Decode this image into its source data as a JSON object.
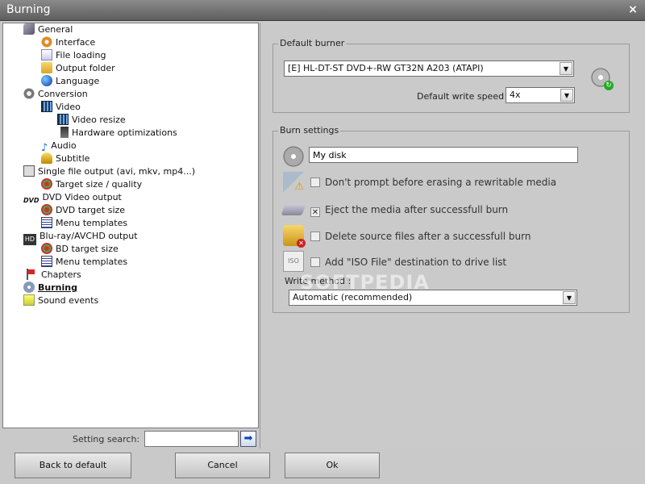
{
  "window": {
    "title": "Burning",
    "close_glyph": "×"
  },
  "tree": [
    {
      "label": "General",
      "icon": "wrench-icon",
      "selected": false
    },
    {
      "label": "Interface",
      "icon": "gear-icon",
      "selected": false
    },
    {
      "label": "File loading",
      "icon": "document-icon",
      "selected": false
    },
    {
      "label": "Output folder",
      "icon": "folder-icon",
      "selected": false
    },
    {
      "label": "Language",
      "icon": "globe-icon",
      "selected": false
    },
    {
      "label": "Conversion",
      "icon": "gear-icon",
      "selected": false
    },
    {
      "label": "Video",
      "icon": "film-icon",
      "selected": false
    },
    {
      "label": "Video resize",
      "icon": "film-icon",
      "selected": false
    },
    {
      "label": "Hardware optimizations",
      "icon": "chip-icon",
      "selected": false
    },
    {
      "label": "Audio",
      "icon": "music-note-icon",
      "selected": false
    },
    {
      "label": "Subtitle",
      "icon": "subtitle-icon",
      "selected": false
    },
    {
      "label": "Single file output (avi, mkv, mp4...)",
      "icon": "camera-icon",
      "selected": false
    },
    {
      "label": "Target size / quality",
      "icon": "target-icon",
      "selected": false
    },
    {
      "label": "DVD Video output",
      "icon": "dvd-icon",
      "selected": false
    },
    {
      "label": "DVD target size",
      "icon": "target-icon",
      "selected": false
    },
    {
      "label": "Menu templates",
      "icon": "menu-template-icon",
      "selected": false
    },
    {
      "label": "Blu-ray/AVCHD output",
      "icon": "hd-icon",
      "selected": false
    },
    {
      "label": "BD target size",
      "icon": "target-icon",
      "selected": false
    },
    {
      "label": "Menu templates",
      "icon": "menu-template-icon",
      "selected": false
    },
    {
      "label": "Chapters",
      "icon": "flag-icon",
      "selected": false
    },
    {
      "label": "Burning",
      "icon": "burn-icon",
      "selected": true
    },
    {
      "label": "Sound events",
      "icon": "sound-icon",
      "selected": false
    }
  ],
  "icon_text": {
    "dvd": "DVD",
    "hd": "HD",
    "note": "♪",
    "iso": "ISO"
  },
  "search": {
    "label": "Setting search:",
    "value": "",
    "go_glyph": "➡"
  },
  "default_burner": {
    "legend": "Default burner",
    "drive": "[E] HL-DT-ST DVD+-RW GT32N A203 (ATAPI)",
    "speed_label": "Default write speed :",
    "speed": "4x",
    "arrow": "▼"
  },
  "burn_settings": {
    "legend": "Burn settings",
    "disk_label": "My disk",
    "options": [
      {
        "label": "Don't prompt before erasing a rewritable media",
        "checked": false,
        "icon": "erase-warning-icon"
      },
      {
        "label": "Eject the media after successfull burn",
        "checked": true,
        "icon": "eject-icon"
      },
      {
        "label": "Delete source files after a successfull burn",
        "checked": false,
        "icon": "delete-folder-icon"
      },
      {
        "label": "Add \"ISO File\" destination to drive list",
        "checked": false,
        "icon": "iso-file-icon"
      }
    ],
    "check_mark": "✕",
    "write_method_label": "Write method :",
    "write_method": "Automatic (recommended)"
  },
  "buttons": {
    "back": "Back to default",
    "cancel": "Cancel",
    "ok": "Ok"
  },
  "watermark": "SOFTPEDIA"
}
